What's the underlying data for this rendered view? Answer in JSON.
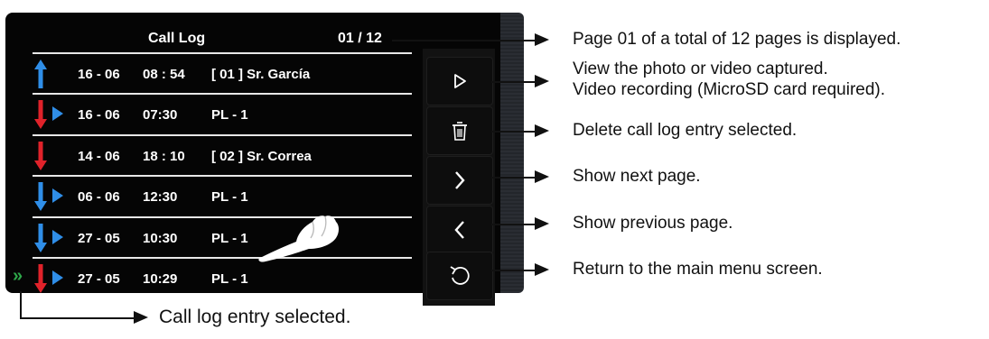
{
  "screen": {
    "title": "Call Log",
    "page": "01 / 12"
  },
  "rows": [
    {
      "dir": "incoming",
      "has_media": false,
      "selected": false,
      "date": "16 - 06",
      "time": "08 : 54",
      "source": "[ 01 ] Sr. García"
    },
    {
      "dir": "missed",
      "has_media": true,
      "selected": false,
      "date": "16 - 06",
      "time": "07:30",
      "source": "PL - 1"
    },
    {
      "dir": "missed",
      "has_media": false,
      "selected": false,
      "date": "14 - 06",
      "time": "18 : 10",
      "source": "[ 02 ]  Sr. Correa"
    },
    {
      "dir": "answered",
      "has_media": true,
      "selected": false,
      "date": "06 - 06",
      "time": "12:30",
      "source": "PL - 1"
    },
    {
      "dir": "answered",
      "has_media": true,
      "selected": false,
      "date": "27 - 05",
      "time": "10:30",
      "source": "PL - 1"
    },
    {
      "dir": "missed",
      "has_media": true,
      "selected": true,
      "date": "27 - 05",
      "time": "10:29",
      "source": "PL - 1"
    }
  ],
  "buttons": [
    {
      "name": "play-button",
      "icon": "play-icon"
    },
    {
      "name": "delete-button",
      "icon": "trash-icon"
    },
    {
      "name": "next-page-button",
      "icon": "chevron-right-icon"
    },
    {
      "name": "previous-page-button",
      "icon": "chevron-left-icon"
    },
    {
      "name": "return-button",
      "icon": "return-icon"
    }
  ],
  "callouts": {
    "page": "Page 01 of a total of 12 pages is displayed.",
    "view_line1": "View the photo or video captured.",
    "view_line2": "Video recording (MicroSD card required).",
    "delete": "Delete call log entry selected.",
    "next": "Show next page.",
    "previous": "Show previous page.",
    "return": "Return to the main menu screen.",
    "selected": "Call log entry selected."
  },
  "colors": {
    "incoming": "#2f8ee8",
    "missed": "#e0222a",
    "answered": "#2f8ee8",
    "selection": "#2ea84a"
  }
}
